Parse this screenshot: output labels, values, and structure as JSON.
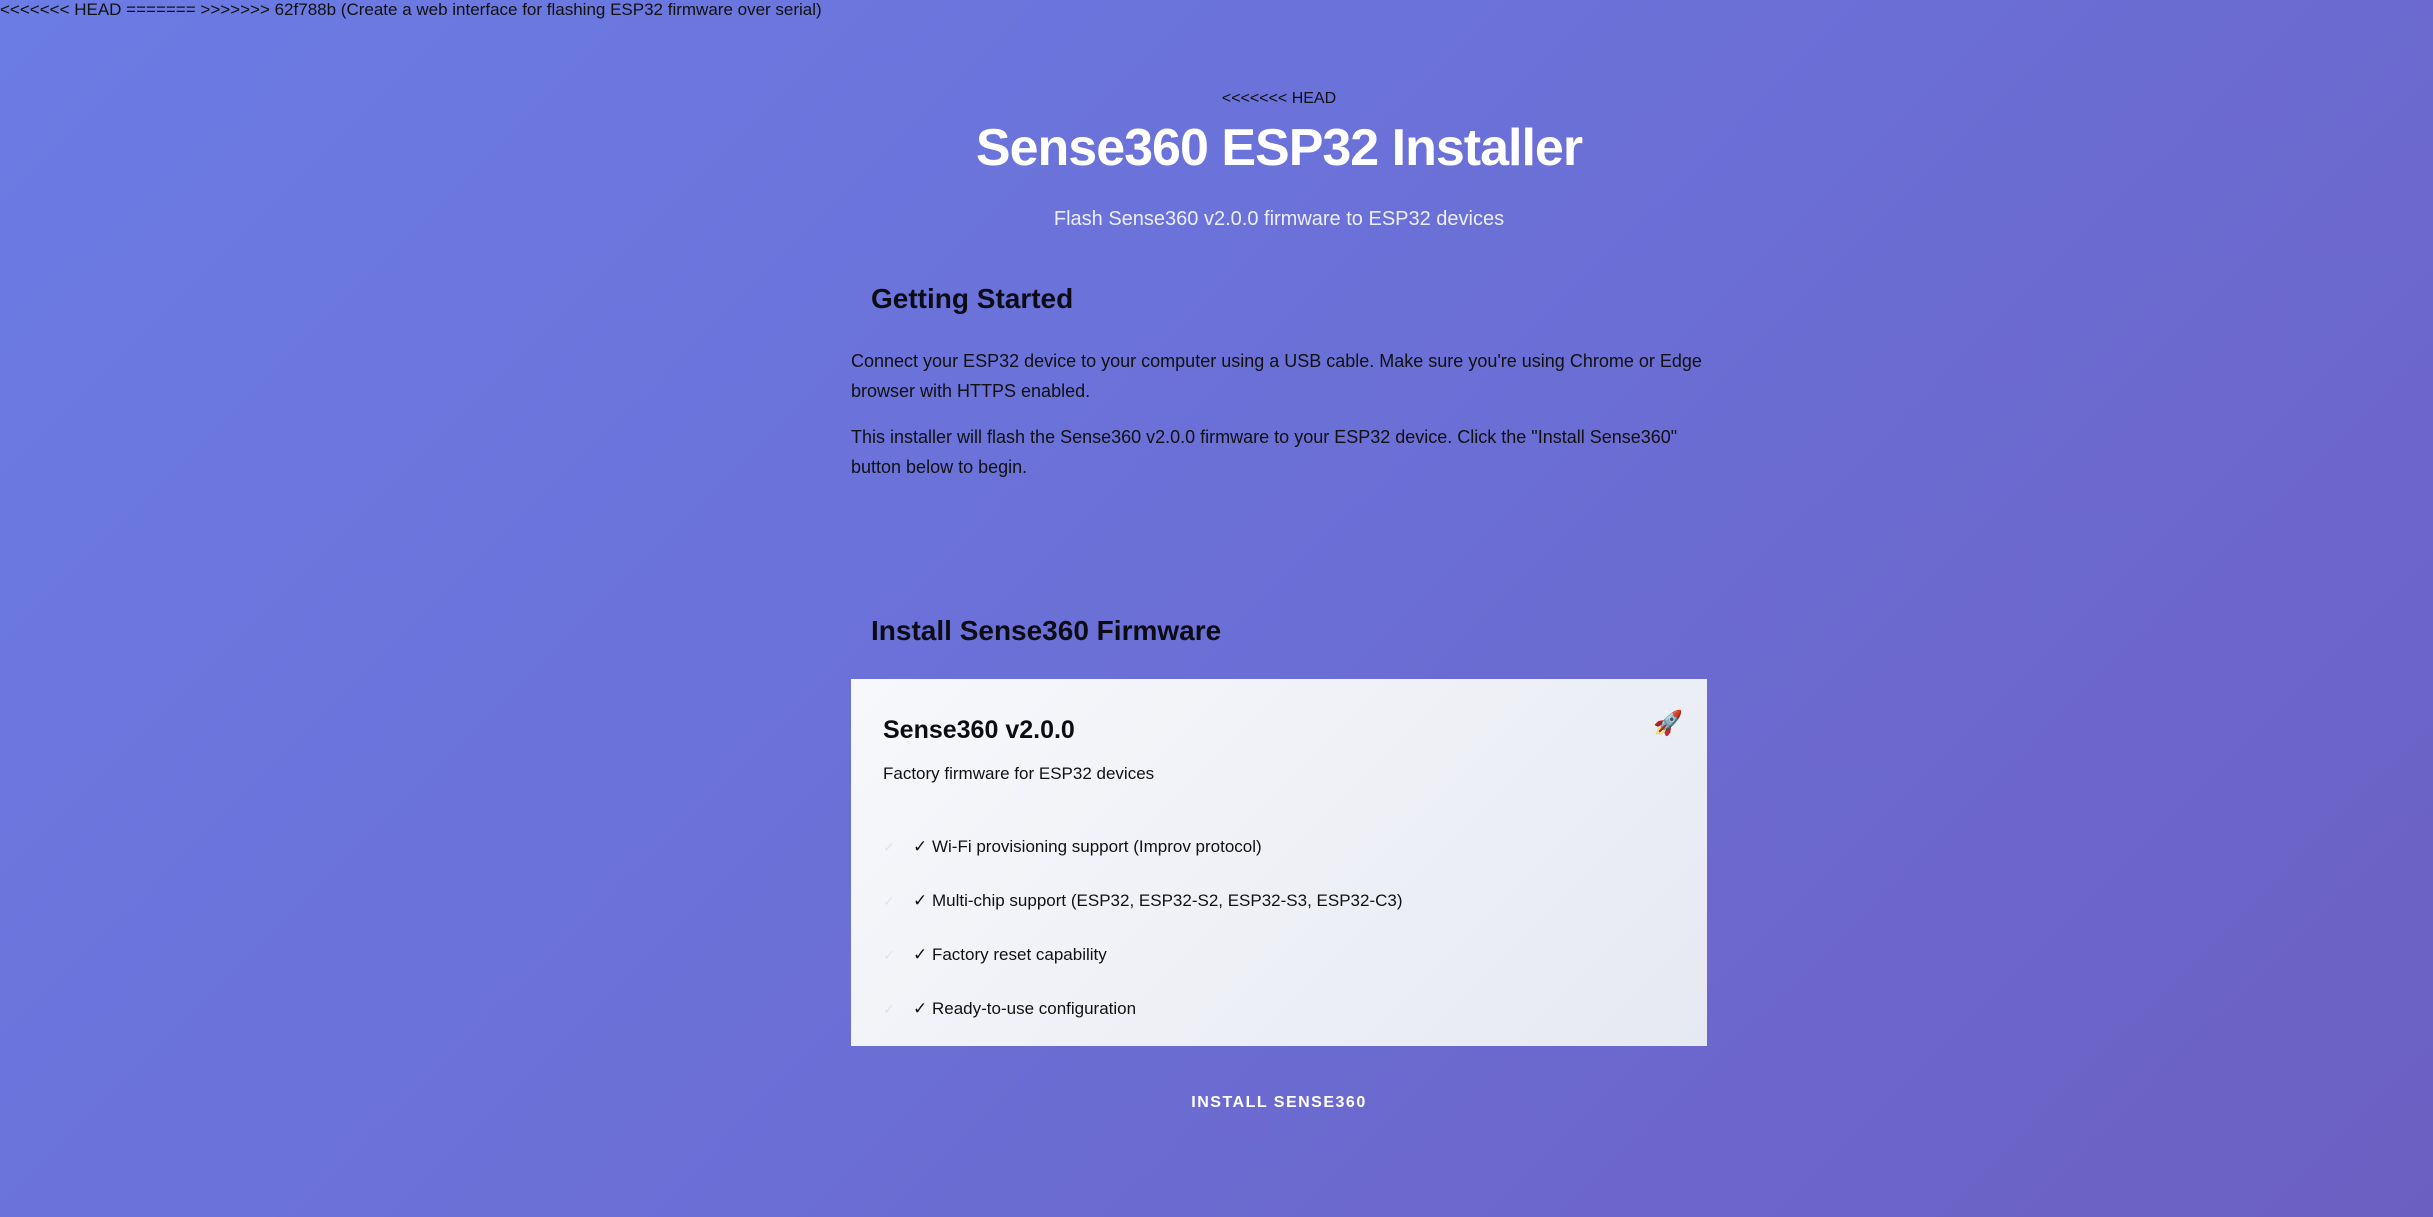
{
  "merge_markers": {
    "top_line": "<<<<<<< HEAD ======= >>>>>>> 62f788b (Create a web interface for flashing ESP32 firmware over serial)",
    "head_marker": "<<<<<<< HEAD"
  },
  "header": {
    "title": "Sense360 ESP32 Installer",
    "subtitle": "Flash Sense360 v2.0.0 firmware to ESP32 devices"
  },
  "getting_started": {
    "title": "Getting Started",
    "paragraphs": [
      "Connect your ESP32 device to your computer using a USB cable. Make sure you're using Chrome or Edge browser with HTTPS enabled.",
      "This installer will flash the Sense360 v2.0.0 firmware to your ESP32 device. Click the \"Install Sense360\" button below to begin."
    ]
  },
  "install": {
    "title": "Install Sense360 Firmware",
    "card": {
      "icon": "rocket-icon",
      "title": "Sense360 v2.0.0",
      "description": "Factory firmware for ESP32 devices",
      "features": [
        "✓ Wi-Fi provisioning support (Improv protocol)",
        "✓ Multi-chip support (ESP32, ESP32-S2, ESP32-S3, ESP32-C3)",
        "✓ Factory reset capability",
        "✓ Ready-to-use configuration"
      ]
    },
    "button_label": "INSTALL SENSE360"
  },
  "colors": {
    "background_start": "#6b7ce4",
    "background_end": "#6c5fc2",
    "title": "#ffffff"
  }
}
